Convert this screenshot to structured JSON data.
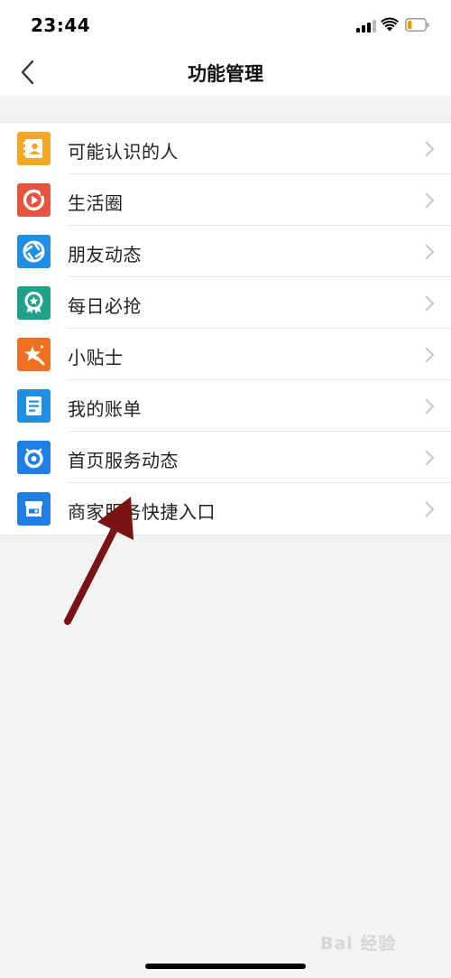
{
  "status_bar": {
    "time": "23:44"
  },
  "nav": {
    "title": "功能管理",
    "back_icon": "chevron-left-icon"
  },
  "colors": {
    "background": "#f3f3f3",
    "row_background": "#ffffff",
    "chevron": "#c7c7cc",
    "annotation_arrow": "#7a1414"
  },
  "items": [
    {
      "label": "可能认识的人",
      "icon": "contact-card-icon",
      "color": "#f5a623"
    },
    {
      "label": "生活圈",
      "icon": "life-circle-icon",
      "color": "#e8533f"
    },
    {
      "label": "朋友动态",
      "icon": "aperture-icon",
      "color": "#1f8fe5"
    },
    {
      "label": "每日必抢",
      "icon": "award-badge-icon",
      "color": "#1fa18a"
    },
    {
      "label": "小贴士",
      "icon": "sparkle-star-icon",
      "color": "#f07020"
    },
    {
      "label": "我的账单",
      "icon": "bill-document-icon",
      "color": "#1f8fe5"
    },
    {
      "label": "首页服务动态",
      "icon": "alarm-ring-icon",
      "color": "#1f7fe5"
    },
    {
      "label": "商家服务快捷入口",
      "icon": "storefront-icon",
      "color": "#1f7fe5"
    }
  ],
  "watermark": {
    "text": "Bai 经验"
  }
}
